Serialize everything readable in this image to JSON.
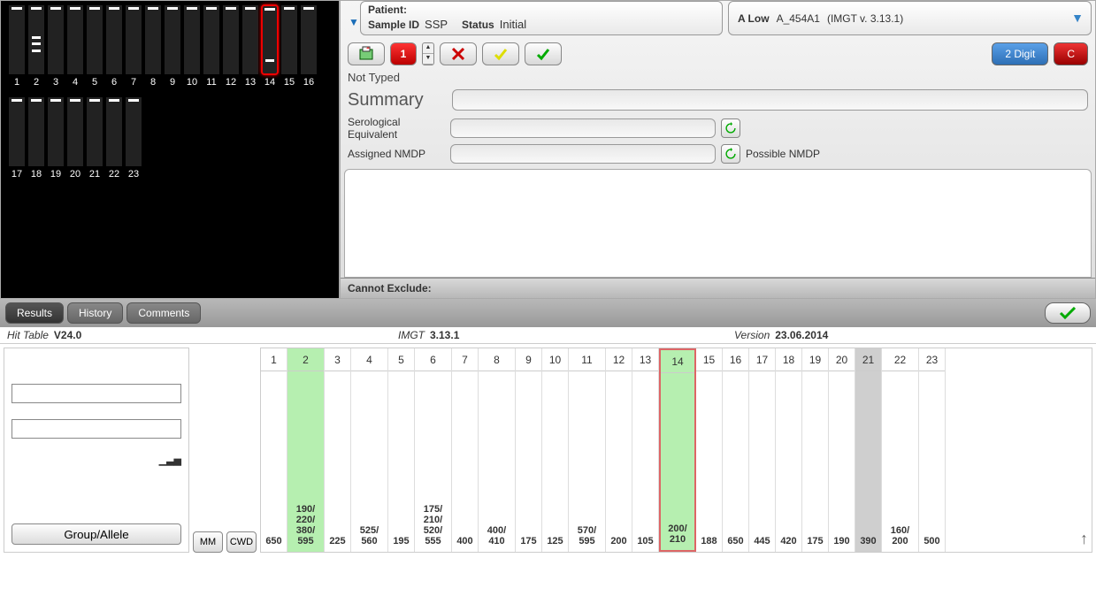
{
  "patient": {
    "patient_label": "Patient:",
    "sampleid_label": "Sample ID",
    "sampleid_value": "SSP",
    "status_label": "Status",
    "status_value": "Initial"
  },
  "locus": {
    "locus_name": "A Low",
    "kit": "A_454A1",
    "imgt": "(IMGT v. 3.13.1)"
  },
  "toolbar": {
    "num": "1",
    "two_digit": "2 Digit",
    "c_btn": "C"
  },
  "not_typed": "Not Typed",
  "summary_label": "Summary",
  "serological_label": "Serological Equivalent",
  "assigned_label": "Assigned NMDP",
  "possible_label": "Possible NMDP",
  "cannot_exclude": "Cannot Exclude:",
  "tabs": {
    "results": "Results",
    "history": "History",
    "comments": "Comments"
  },
  "hit_header": {
    "hit_table": "Hit Table",
    "version_v": "V24.0",
    "imgt_label": "IMGT",
    "imgt_val": "3.13.1",
    "version_label": "Version",
    "version_val": "23.06.2014"
  },
  "filter": {
    "group_allele": "Group/Allele",
    "mm": "MM",
    "cwd": "CWD"
  },
  "gel": {
    "row1": [
      1,
      2,
      3,
      4,
      5,
      6,
      7,
      8,
      9,
      10,
      11,
      12,
      13,
      14,
      15,
      16
    ],
    "row2": [
      17,
      18,
      19,
      20,
      21,
      22,
      23
    ],
    "selected_lane": 14
  },
  "lane_cols": [
    {
      "n": 1,
      "v": "650"
    },
    {
      "n": 2,
      "v": "190/\n220/\n380/\n595",
      "green": true
    },
    {
      "n": 3,
      "v": "225"
    },
    {
      "n": 4,
      "v": "525/\n560"
    },
    {
      "n": 5,
      "v": "195"
    },
    {
      "n": 6,
      "v": "175/\n210/\n520/\n555"
    },
    {
      "n": 7,
      "v": "400"
    },
    {
      "n": 8,
      "v": "400/\n410"
    },
    {
      "n": 9,
      "v": "175"
    },
    {
      "n": 10,
      "v": "125"
    },
    {
      "n": 11,
      "v": "570/\n595"
    },
    {
      "n": 12,
      "v": "200"
    },
    {
      "n": 13,
      "v": "105"
    },
    {
      "n": 14,
      "v": "200/\n210",
      "green": true,
      "selected": true
    },
    {
      "n": 15,
      "v": "188"
    },
    {
      "n": 16,
      "v": "650"
    },
    {
      "n": 17,
      "v": "445"
    },
    {
      "n": 18,
      "v": "420"
    },
    {
      "n": 19,
      "v": "175"
    },
    {
      "n": 20,
      "v": "190"
    },
    {
      "n": 21,
      "v": "390",
      "grey": true
    },
    {
      "n": 22,
      "v": "160/\n200"
    },
    {
      "n": 23,
      "v": "500"
    }
  ]
}
